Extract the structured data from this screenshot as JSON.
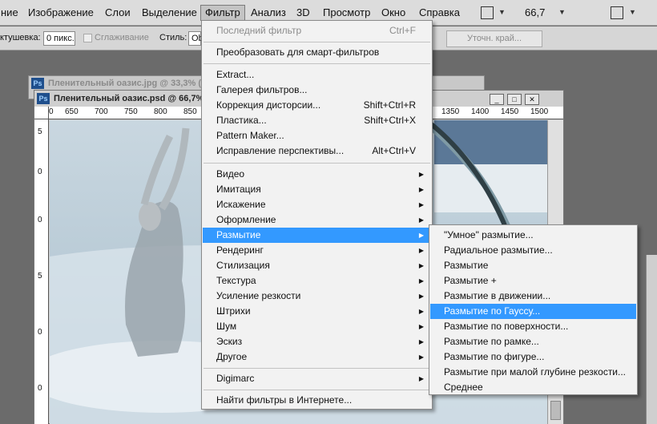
{
  "menubar": {
    "items": [
      "ние",
      "Изображение",
      "Слои",
      "Выделение",
      "Фильтр",
      "Анализ",
      "3D",
      "Просмотр",
      "Окно",
      "Справка"
    ],
    "zoom": "66,7"
  },
  "options": {
    "feather_label": "ктушевка:",
    "feather_value": "0 пикс.",
    "antialias_label": "Сглаживание",
    "style_label": "Стиль:",
    "style_value": "Ob",
    "refine_edge": "Уточн. край..."
  },
  "documents": {
    "back_title": "Пленительный оазис.jpg @ 33,3% (",
    "front_title": "Пленительный оазис.psd @ 66,7%",
    "ps_icon": "Ps",
    "ruler_ticks": [
      "0",
      "650",
      "700",
      "750",
      "800",
      "850",
      "1350",
      "1400",
      "1450",
      "1500"
    ],
    "ruler_v_ticks": [
      "5",
      "0",
      "0",
      "5",
      "0",
      "0"
    ]
  },
  "filter_menu": {
    "last_filter": "Последний фильтр",
    "last_filter_shortcut": "Ctrl+F",
    "smart": "Преобразовать для смарт-фильтров",
    "group1": [
      {
        "label": "Extract...",
        "shortcut": ""
      },
      {
        "label": "Галерея фильтров...",
        "shortcut": ""
      },
      {
        "label": "Коррекция дисторсии...",
        "shortcut": "Shift+Ctrl+R"
      },
      {
        "label": "Пластика...",
        "shortcut": "Shift+Ctrl+X"
      },
      {
        "label": "Pattern Maker...",
        "shortcut": ""
      },
      {
        "label": "Исправление перспективы...",
        "shortcut": "Alt+Ctrl+V"
      }
    ],
    "group2": [
      "Видео",
      "Имитация",
      "Искажение",
      "Оформление",
      "Размытие",
      "Рендеринг",
      "Стилизация",
      "Текстура",
      "Усиление резкости",
      "Штрихи",
      "Шум",
      "Эскиз",
      "Другое"
    ],
    "highlighted": "Размытие",
    "digimarc": "Digimarc",
    "online": "Найти фильтры в Интернете..."
  },
  "blur_submenu": {
    "items": [
      "\"Умное\" размытие...",
      "Радиальное размытие...",
      "Размытие",
      "Размытие +",
      "Размытие в движении...",
      "Размытие по Гауссу...",
      "Размытие по поверхности...",
      "Размытие по рамке...",
      "Размытие по фигуре...",
      "Размытие при малой глубине резкости...",
      "Среднее"
    ],
    "highlighted_index": 5
  },
  "colors": {
    "highlight": "#3399ff",
    "menu_bg": "#f2f2f2"
  }
}
